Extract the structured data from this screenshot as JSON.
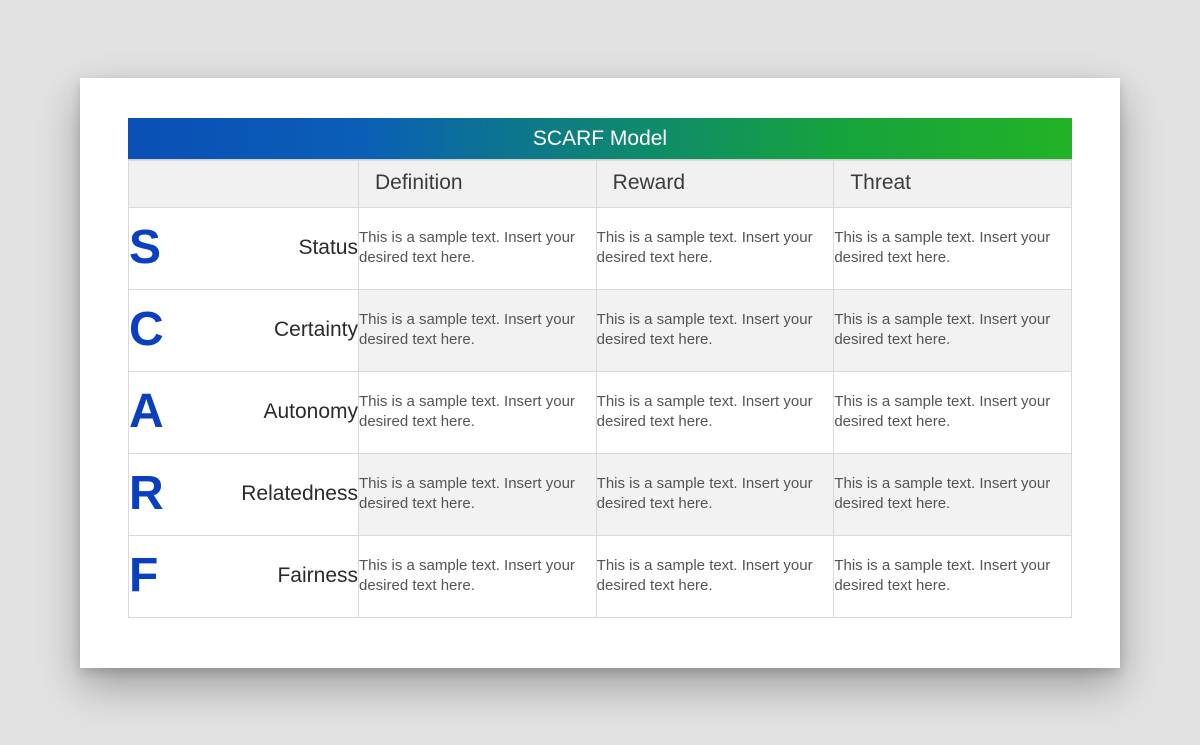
{
  "title": "SCARF Model",
  "sample_text": "This is a sample text. Insert your desired text here.",
  "columns": [
    "Definition",
    "Reward",
    "Threat"
  ],
  "rows": [
    {
      "letter": "S",
      "word": "Status"
    },
    {
      "letter": "C",
      "word": "Certainty"
    },
    {
      "letter": "A",
      "word": "Autonomy"
    },
    {
      "letter": "R",
      "word": "Relatedness"
    },
    {
      "letter": "F",
      "word": "Fairness"
    }
  ],
  "colors": {
    "letter": "#0a3fbf",
    "gradient_start": "#0a4fb5",
    "gradient_end": "#22b326"
  }
}
